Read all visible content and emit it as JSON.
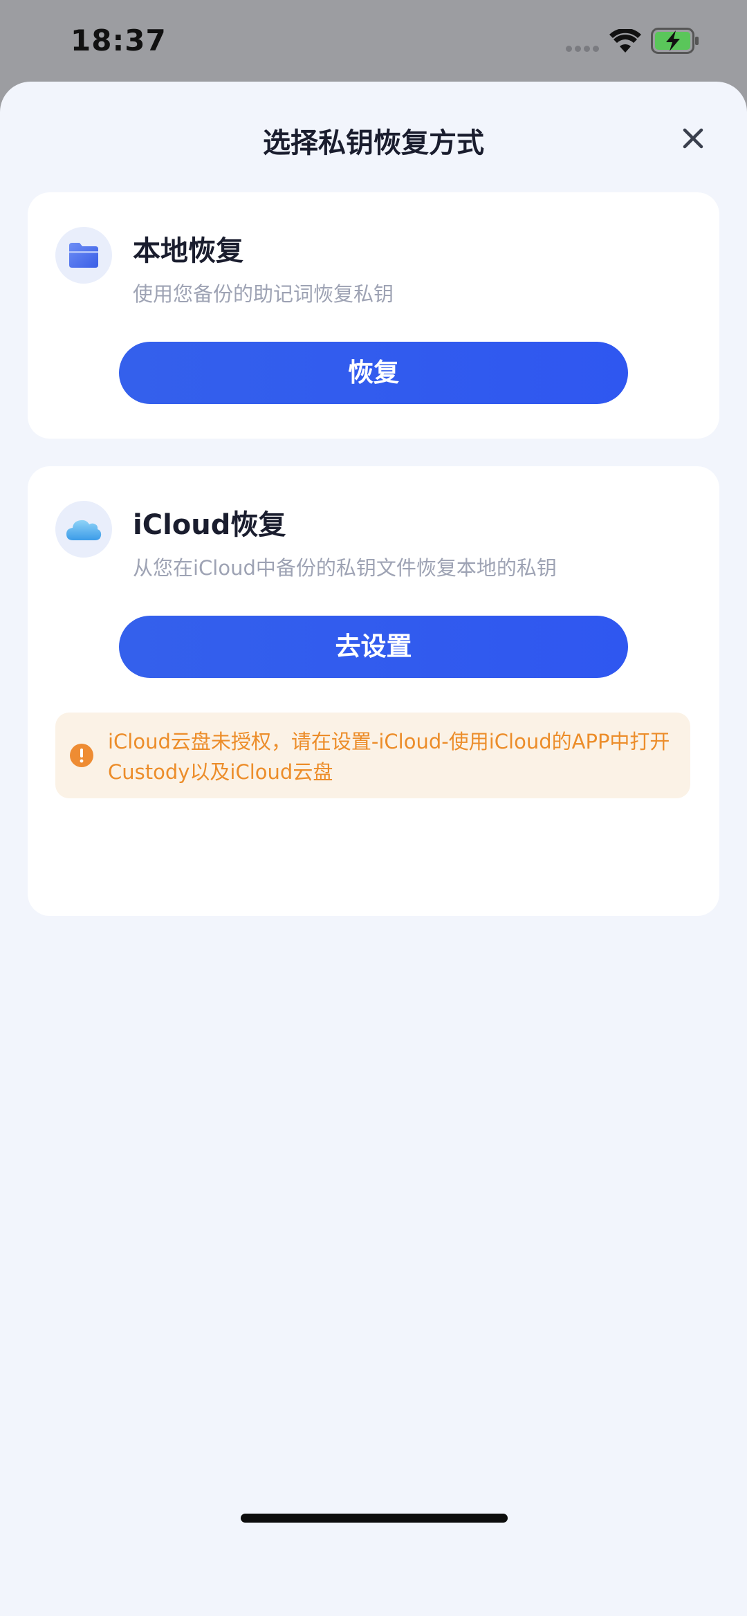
{
  "status_bar": {
    "time": "18:37",
    "icons": [
      "signal-dots-icon",
      "wifi-icon",
      "battery-charging-icon"
    ]
  },
  "sheet": {
    "title": "选择私钥恢复方式",
    "close_icon": "close-icon"
  },
  "local_restore": {
    "icon": "folder-icon",
    "title": "本地恢复",
    "description": "使用您备份的助记词恢复私钥",
    "button_label": "恢复"
  },
  "icloud_restore": {
    "icon": "cloud-icon",
    "title": "iCloud恢复",
    "description": "从您在iCloud中备份的私钥文件恢复本地的私钥",
    "button_label": "去设置",
    "warning": "iCloud云盘未授权，请在设置-iCloud-使用iCloud的APP中打开 Custody以及iCloud云盘",
    "warning_icon": "exclamation-circle-icon"
  },
  "colors": {
    "accent": "#2f57f0",
    "warning_text": "#ec8d2a",
    "warning_bg": "#fbf2e6",
    "page_bg": "#f2f5fc"
  }
}
